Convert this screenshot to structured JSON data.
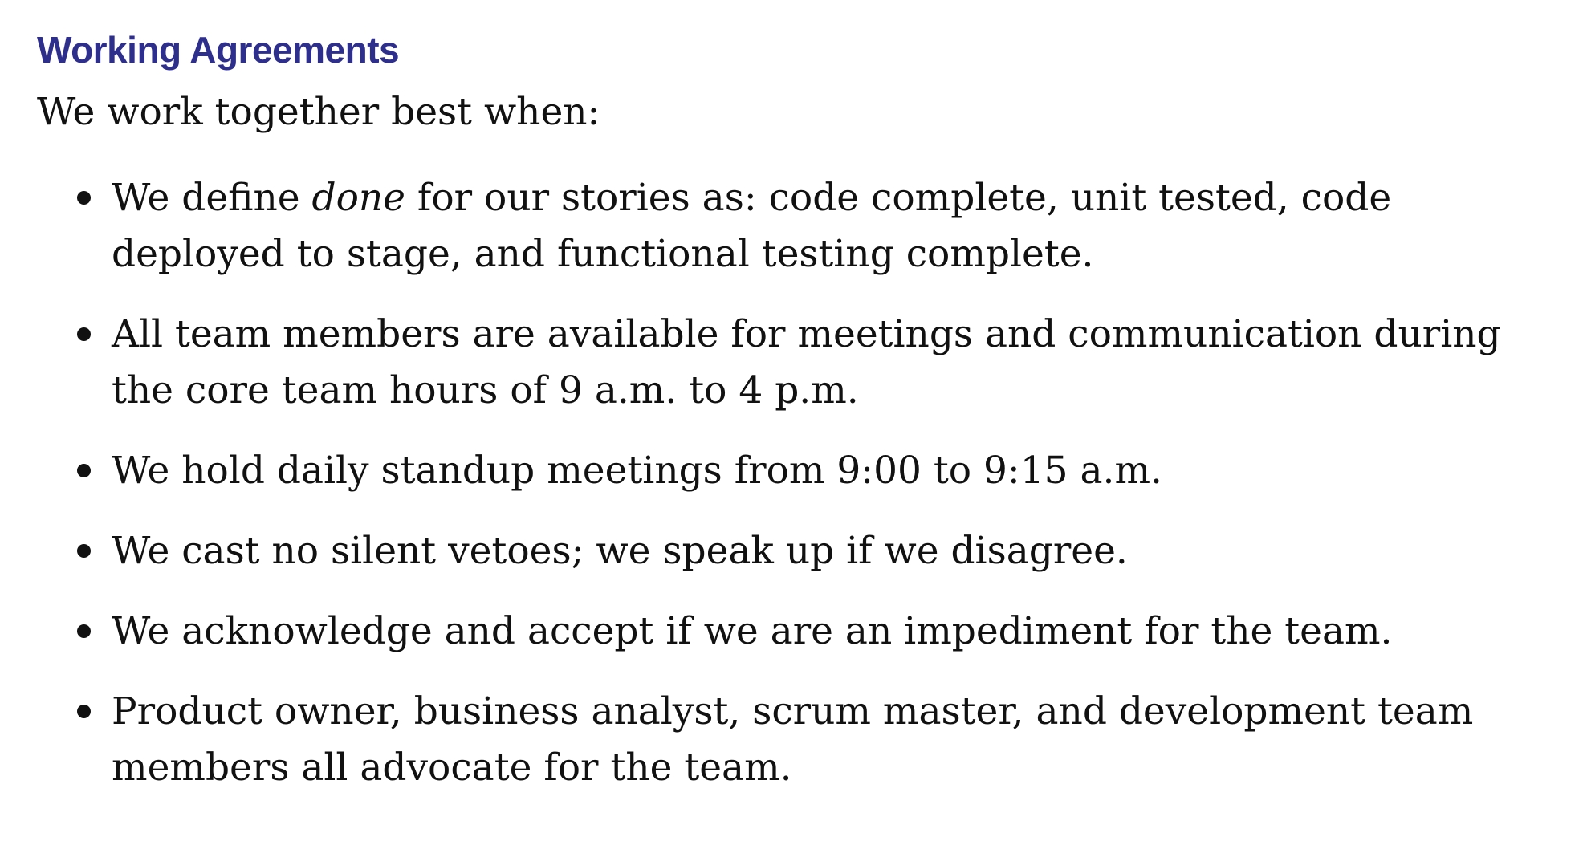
{
  "document": {
    "heading": "Working Agreements",
    "intro": "We work together best when:",
    "items": [
      {
        "before": "We define ",
        "emphasis": "done",
        "after": " for our stories as: code complete, unit tested, code deployed to stage, and functional testing complete."
      },
      {
        "text": "All team members are available for meetings and communication during the core team hours of 9 a.m. to 4 p.m."
      },
      {
        "text": "We hold daily standup meetings from 9:00 to 9:15 a.m."
      },
      {
        "text": "We cast no silent vetoes; we speak up if we disagree."
      },
      {
        "text": "We acknowledge and accept if we are an impediment for the team."
      },
      {
        "text": "Product owner, business analyst, scrum master, and development team members all advocate for the team."
      }
    ]
  },
  "colors": {
    "heading": "#2e2e8c",
    "body_text": "#111111",
    "background": "#ffffff"
  }
}
